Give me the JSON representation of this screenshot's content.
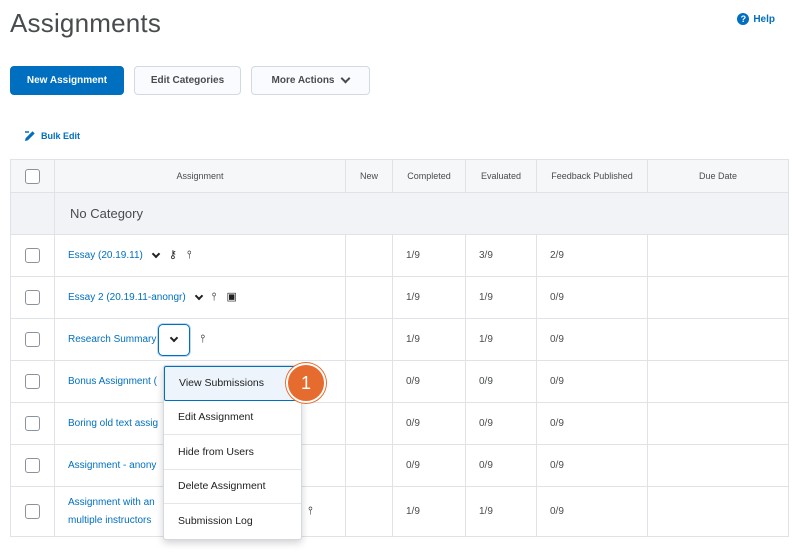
{
  "page": {
    "title": "Assignments",
    "help_label": "Help"
  },
  "toolbar": {
    "new_assignment": "New Assignment",
    "edit_categories": "Edit Categories",
    "more_actions": "More Actions",
    "bulk_edit": "Bulk Edit"
  },
  "table": {
    "headers": [
      "Assignment",
      "New",
      "Completed",
      "Evaluated",
      "Feedback Published",
      "Due Date"
    ],
    "category": "No Category",
    "rows": [
      {
        "name": "Essay (20.19.11)",
        "completed": "1/9",
        "evaluated": "3/9",
        "feedback": "2/9"
      },
      {
        "name": "Essay 2 (20.19.11-anongr)",
        "completed": "1/9",
        "evaluated": "1/9",
        "feedback": "0/9"
      },
      {
        "name": "Research Summary",
        "completed": "1/9",
        "evaluated": "1/9",
        "feedback": "0/9"
      },
      {
        "name": "Bonus Assignment (",
        "completed": "0/9",
        "evaluated": "0/9",
        "feedback": "0/9"
      },
      {
        "name": "Boring old text assig",
        "completed": "0/9",
        "evaluated": "0/9",
        "feedback": "0/9"
      },
      {
        "name": "Assignment - anony",
        "completed": "0/9",
        "evaluated": "0/9",
        "feedback": "0/9"
      },
      {
        "name_line1": "Assignment with an",
        "name_line2": "multiple instructors",
        "completed": "1/9",
        "evaluated": "1/9",
        "feedback": "0/9"
      }
    ]
  },
  "context_menu": {
    "items": [
      "View Submissions",
      "Edit Assignment",
      "Hide from Users",
      "Delete Assignment",
      "Submission Log"
    ],
    "active_index": 0
  },
  "callout": {
    "number": "1"
  },
  "colors": {
    "accent": "#006fbf",
    "callout": "#e56b2e"
  }
}
